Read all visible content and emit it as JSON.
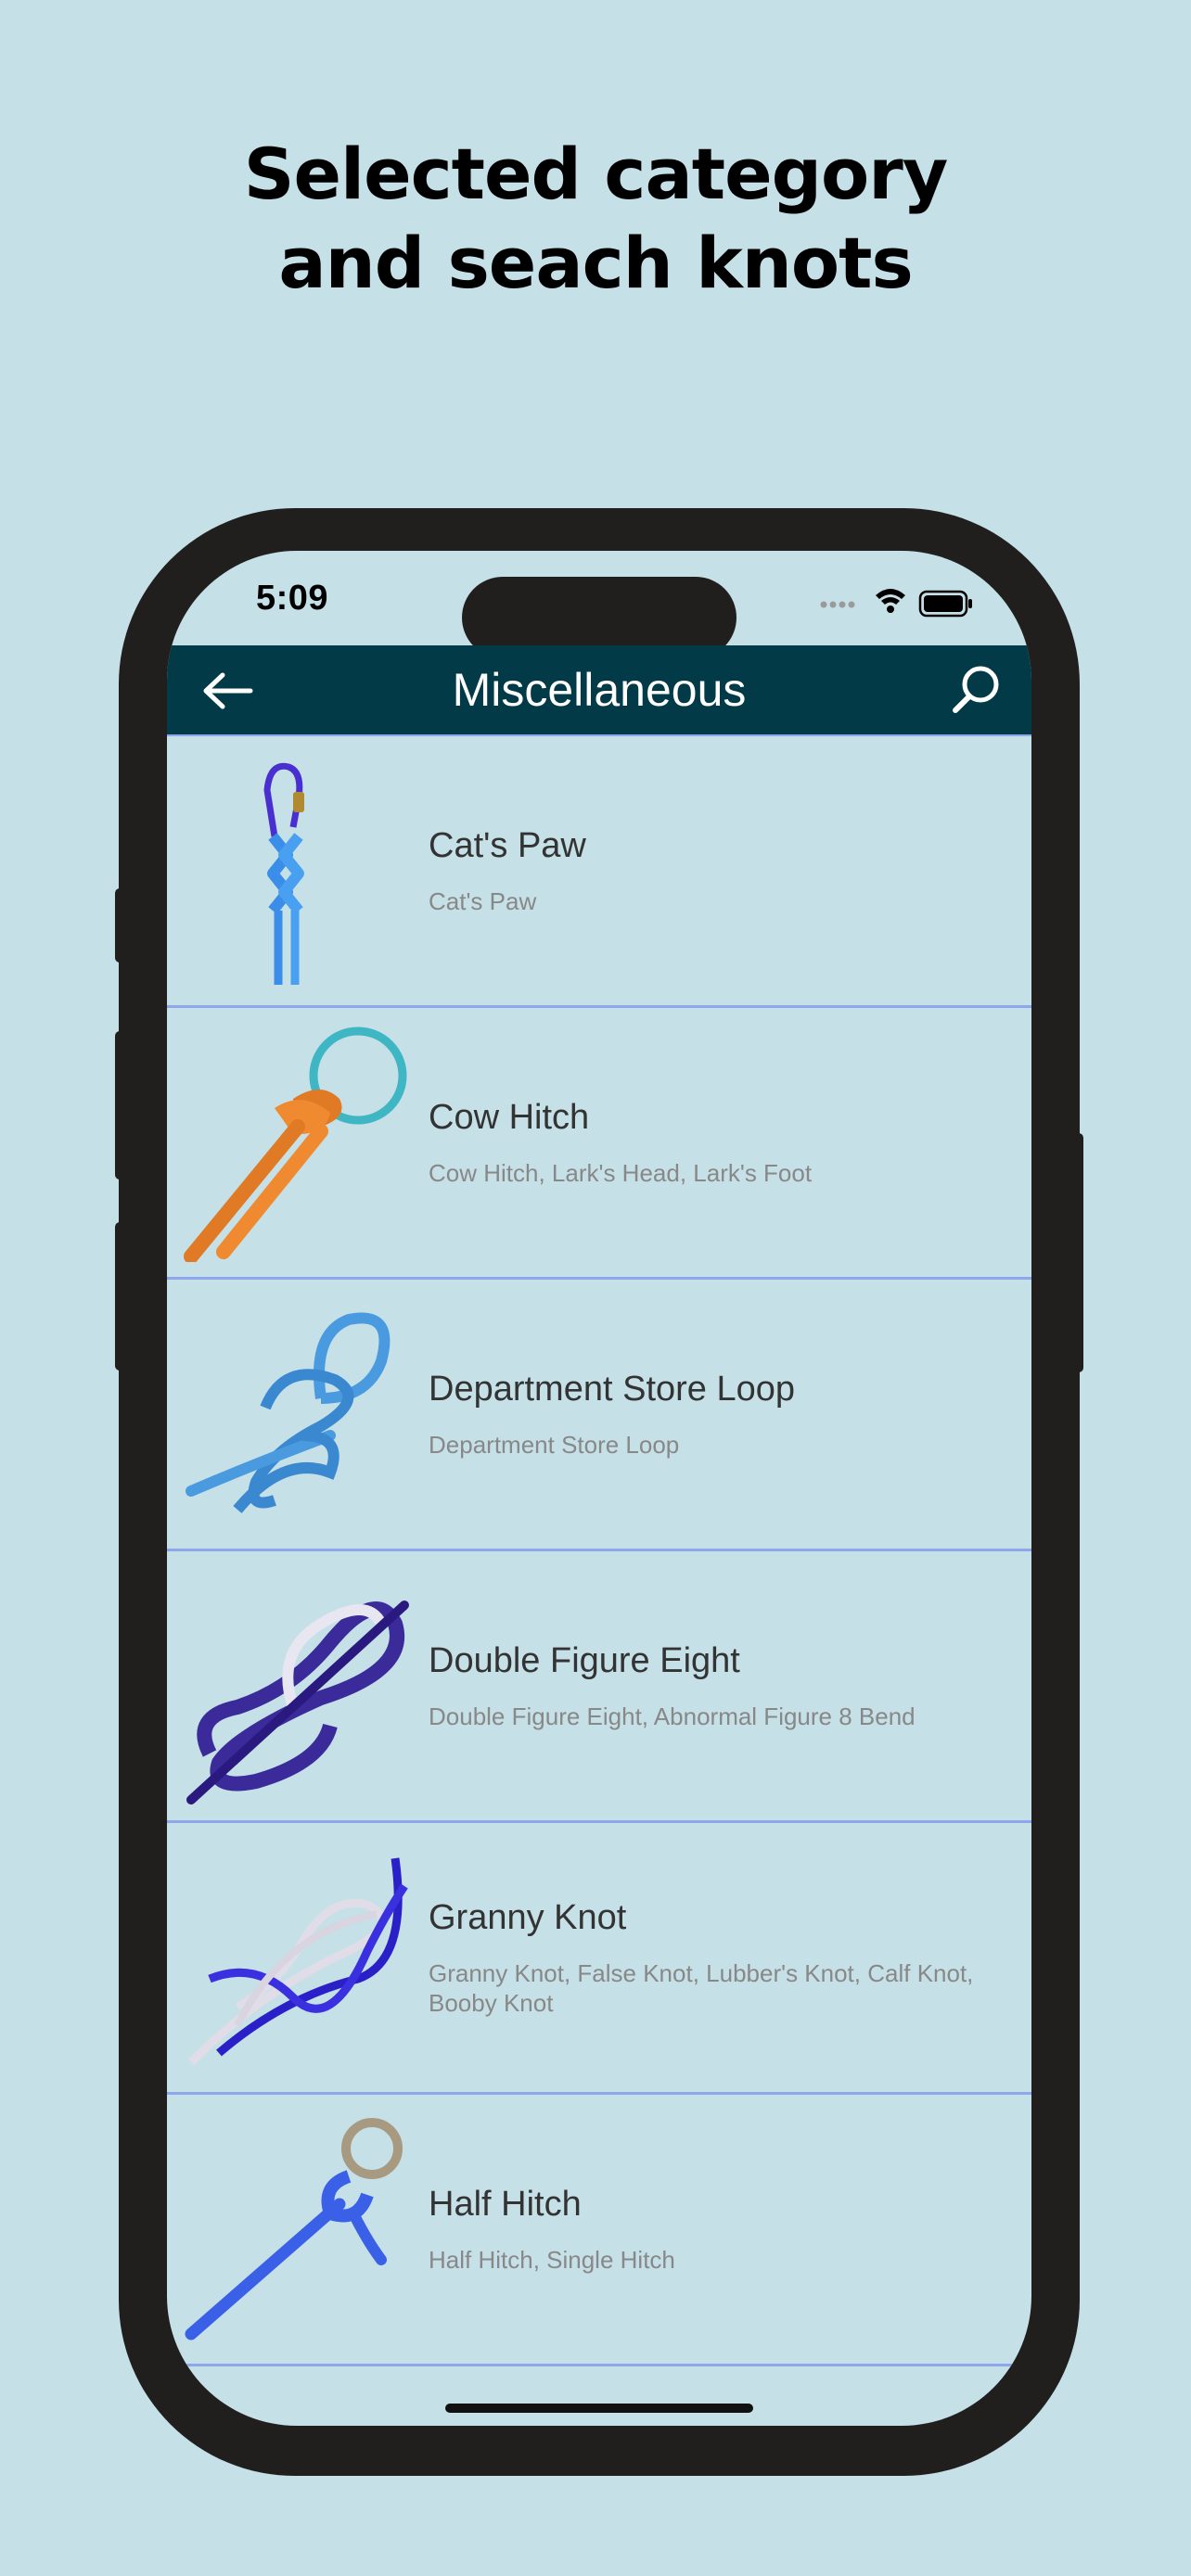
{
  "promo": {
    "headline_line1": "Selected category",
    "headline_line2": "and seach knots"
  },
  "status_bar": {
    "time": "5:09",
    "icons": [
      "signal-dots-icon",
      "wifi-icon",
      "battery-icon"
    ]
  },
  "nav": {
    "title": "Miscellaneous",
    "back_icon": "arrow-left-icon",
    "search_icon": "search-icon",
    "background": "#023a47"
  },
  "knots": [
    {
      "title": "Cat's Paw",
      "subtitle": "Cat's Paw",
      "icon": "cats-paw-knot-image"
    },
    {
      "title": "Cow Hitch",
      "subtitle": "Cow Hitch, Lark's Head, Lark's Foot",
      "icon": "cow-hitch-knot-image"
    },
    {
      "title": "Department Store Loop",
      "subtitle": "Department Store Loop",
      "icon": "department-store-loop-image"
    },
    {
      "title": "Double Figure Eight",
      "subtitle": "Double Figure Eight, Abnormal Figure 8 Bend",
      "icon": "double-figure-eight-image"
    },
    {
      "title": "Granny Knot",
      "subtitle": "Granny Knot, False Knot, Lubber's Knot, Calf Knot, Booby Knot",
      "icon": "granny-knot-image"
    },
    {
      "title": "Half Hitch",
      "subtitle": "Half Hitch, Single Hitch",
      "icon": "half-hitch-image"
    }
  ],
  "colors": {
    "background": "#c5e0e7",
    "divider": "#8ea6ec",
    "phone_frame": "#211f1d"
  }
}
